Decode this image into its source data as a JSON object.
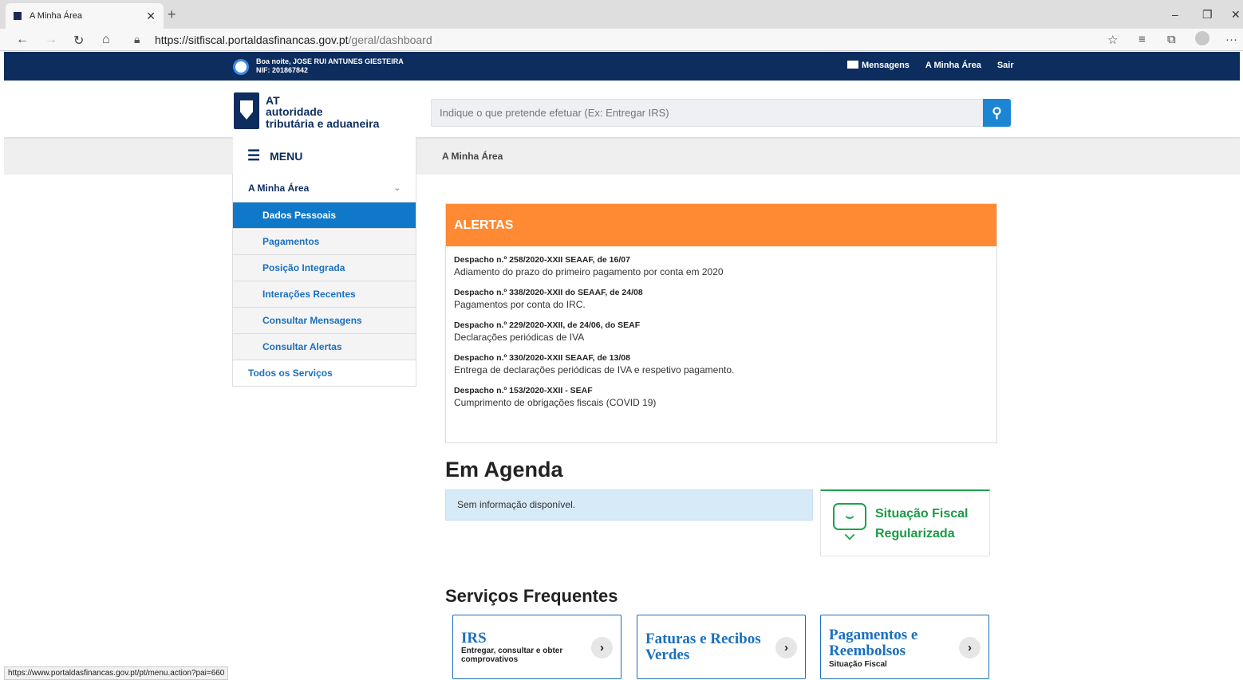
{
  "browser": {
    "tab_title": "A Minha Área",
    "new_tab": "+",
    "url_main": "https://sitfiscal.portaldasfinancas.gov.pt",
    "url_path": "/geral/dashboard",
    "status_url": "https://www.portaldasfinancas.gov.pt/pt/menu.action?pai=660"
  },
  "topbar": {
    "greeting": "Boa noite, JOSE RUI ANTUNES GIESTEIRA",
    "nif": "NIF: 201867842",
    "links": [
      "Mensagens",
      "A Minha Área",
      "Sair"
    ]
  },
  "logo": {
    "line1": "AT",
    "line2": "autoridade",
    "line3": "tributária e aduaneira"
  },
  "search": {
    "placeholder": "Indique o que pretende efetuar (Ex: Entregar IRS)"
  },
  "menu": {
    "label": "MENU",
    "breadcrumb": "A Minha Área"
  },
  "sidebar": {
    "section": "A Minha Área",
    "items": [
      {
        "label": "Dados Pessoais"
      },
      {
        "label": "Pagamentos"
      },
      {
        "label": "Posição Integrada"
      },
      {
        "label": "Interações Recentes"
      },
      {
        "label": "Consultar Mensagens"
      },
      {
        "label": "Consultar Alertas"
      }
    ],
    "footer": "Todos os Serviços"
  },
  "alerts": {
    "title": "ALERTAS",
    "items": [
      {
        "title": "Despacho n.º 258/2020-XXII SEAAF, de 16/07",
        "desc": "Adiamento do prazo do primeiro pagamento por conta em 2020"
      },
      {
        "title": "Despacho n.º 338/2020-XXII do SEAAF, de 24/08",
        "desc": "Pagamentos por conta do IRC."
      },
      {
        "title": "Despacho n.º 229/2020-XXII, de 24/06, do SEAF",
        "desc": "Declarações periódicas de IVA"
      },
      {
        "title": "Despacho n.º 330/2020-XXII SEAAF, de 13/08",
        "desc": "Entrega de declarações periódicas de IVA e respetivo pagamento."
      },
      {
        "title": "Despacho n.º 153/2020-XXII - SEAF",
        "desc": "Cumprimento de obrigações fiscais (COVID 19)"
      }
    ]
  },
  "agenda": {
    "title": "Em Agenda",
    "no_info": "Sem informação disponível."
  },
  "fiscal_status": {
    "line1": "Situação Fiscal",
    "line2": "Regularizada"
  },
  "services": {
    "title": "Serviços Frequentes",
    "cards": [
      {
        "title": "IRS",
        "subtitle": "Entregar, consultar e obter comprovativos"
      },
      {
        "title": "Faturas e Recibos Verdes",
        "subtitle": ""
      },
      {
        "title": "Pagamentos e Reembolsos",
        "subtitle": "Situação Fiscal"
      }
    ]
  }
}
